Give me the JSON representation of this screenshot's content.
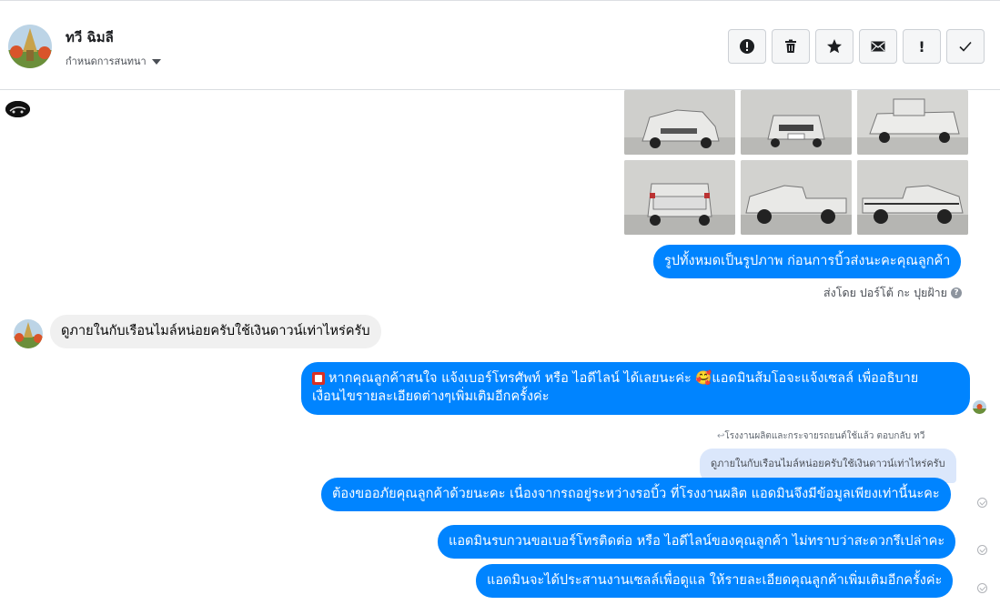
{
  "header": {
    "contact_name": "ทวี ฉิมลี",
    "assign_label": "กำหนดการสนทนา"
  },
  "actions": {
    "exclaim_label": "!"
  },
  "messages": {
    "caption": "รูปทั้งหมดเป็นรูปภาพ ก่อนการบิ้วส่งนะคะคุณลูกค้า",
    "sent_by": "ส่งโดย ปอร์โต้ กะ ปุยฝ้าย",
    "sent_by_help": "?",
    "customer_question": "ดูภายในกับเรือนไมล์หน่อยครับใช้เงินดาวน์เท่าไหร่ครับ",
    "promo_line1": "หากคุณลูกค้าสนใจ แจ้งเบอร์โทรศัพท์ หรือ ไอดีไลน์  ได้เลยนะค่ะ 🥰แอดมินส้มโอจะแจ้งเซลล์   เพื่ออธิบาย",
    "promo_line2": "เงื่อนไขรายละเอียดต่างๆเพิ่มเติมอีกครั้งค่ะ",
    "reply_header": "โรงงานผลิตและกระจายรถยนต์ใช้แล้ว ตอบกลับ ทวี",
    "quoted": "ดูภายในกับเรือนไมล์หน่อยครับใช้เงินดาวน์เท่าไหร่ครับ",
    "reply1": "ต้องขออภัยคุณลูกค้าด้วยนะคะ เนื่องจากรถอยู่ระหว่างรอบิ้ว ที่โรงงานผลิต แอดมินจึงมีข้อมูลเพียงเท่านี้นะคะ",
    "reply2": "แอดมินรบกวนขอเบอร์โทรติดต่อ หรือ ไอดีไลน์ของคุณลูกค้า ไม่ทราบว่าสะดวกรึเปล่าคะ",
    "reply3": "แอดมินจะได้ประสานงานเซลล์เพื่อดูแล ให้รายละเอียดคุณลูกค้าเพิ่มเติมอีกครั้งค่ะ"
  },
  "colors": {
    "outgoing_bubble": "#0084ff",
    "incoming_bubble": "#f0f0f0",
    "quoted_bubble": "#dbe7fb"
  },
  "icons": [
    "alert-circle-icon",
    "trash-icon",
    "star-icon",
    "envelope-icon",
    "exclamation-icon",
    "check-icon"
  ]
}
